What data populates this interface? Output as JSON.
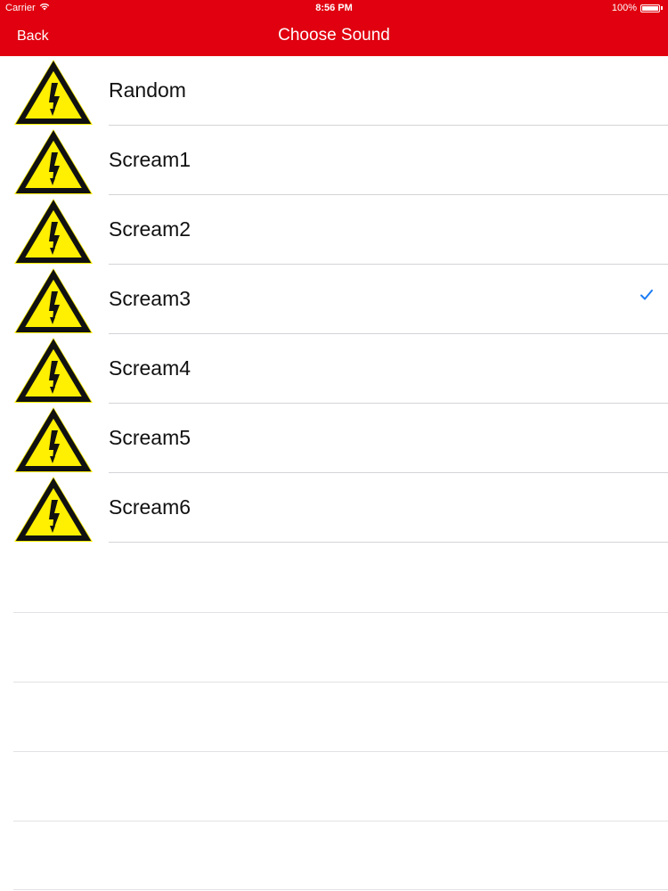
{
  "status_bar": {
    "carrier": "Carrier",
    "time": "8:56 PM",
    "battery": "100%"
  },
  "nav": {
    "back_label": "Back",
    "title": "Choose Sound",
    "background_color": "#e0000f"
  },
  "list": {
    "items": [
      {
        "label": "Random",
        "icon": "high-voltage-warning-icon",
        "selected": false
      },
      {
        "label": "Scream1",
        "icon": "high-voltage-warning-icon",
        "selected": false
      },
      {
        "label": "Scream2",
        "icon": "high-voltage-warning-icon",
        "selected": false
      },
      {
        "label": "Scream3",
        "icon": "high-voltage-warning-icon",
        "selected": true
      },
      {
        "label": "Scream4",
        "icon": "high-voltage-warning-icon",
        "selected": false
      },
      {
        "label": "Scream5",
        "icon": "high-voltage-warning-icon",
        "selected": false
      },
      {
        "label": "Scream6",
        "icon": "high-voltage-warning-icon",
        "selected": false
      }
    ],
    "checkmark_color": "#1a7cf5",
    "warning_yellow": "#ffef00"
  }
}
